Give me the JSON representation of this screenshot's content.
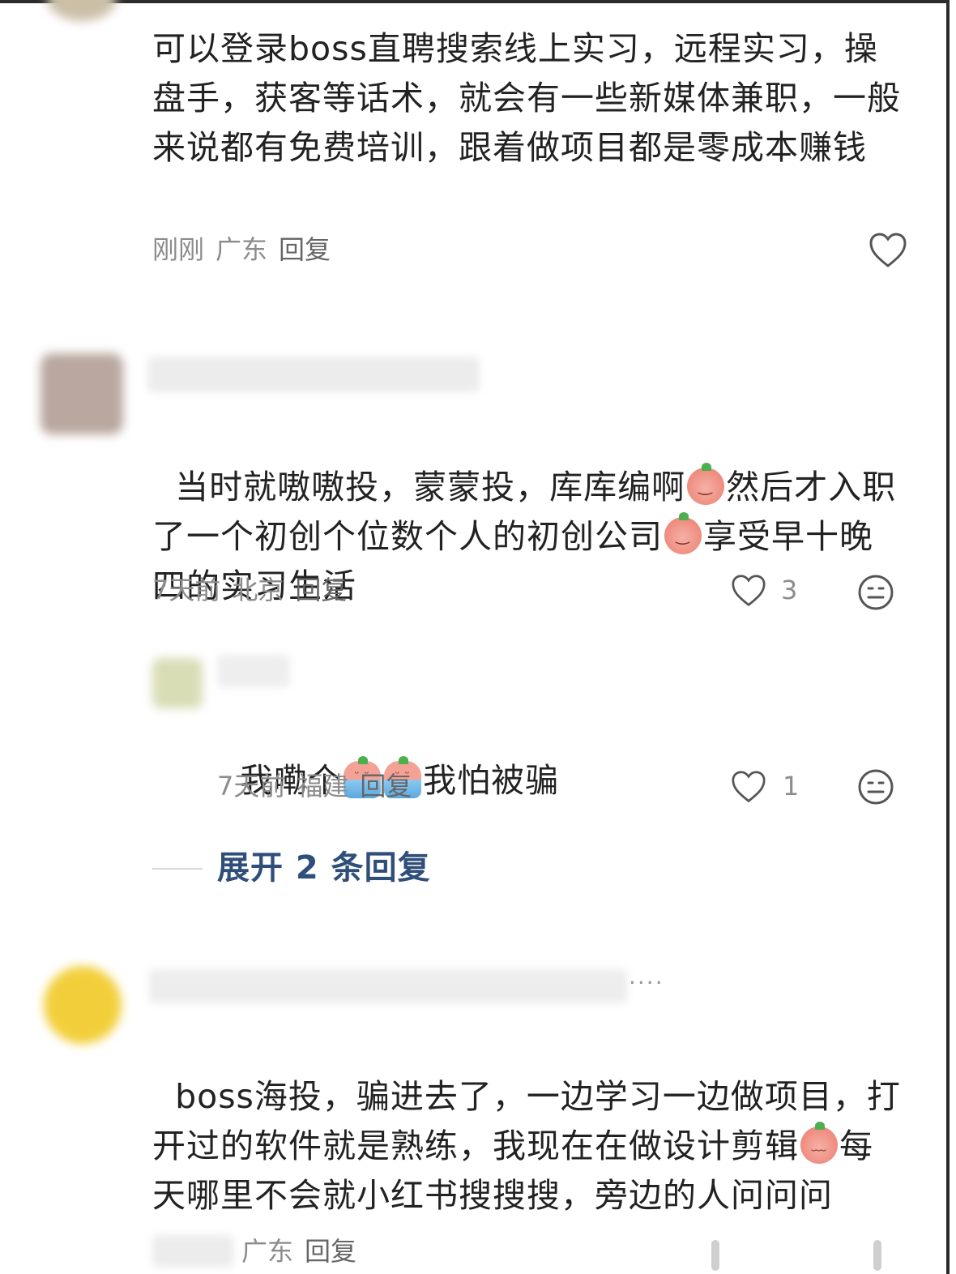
{
  "comments": [
    {
      "text": "可以登录boss直聘搜索线上实习，远程实习，操盘手，获客等话术，就会有一些新媒体兼职，一般来说都有免费培训，跟着做项目都是零成本赚钱",
      "time": "刚刚",
      "location": "广东",
      "reply_label": "回复"
    },
    {
      "text_part1": "当时就嗷嗷投，蒙蒙投，库库编啊",
      "text_part2": "然后才入职了一个初创个位数个人的初创公司",
      "text_part3": "享受早十晚四的实习生活",
      "time": "7天前",
      "location": "北京",
      "reply_label": "回复",
      "likes": "3",
      "sub_reply": {
        "text_part1": "我嘞个",
        "text_part2": "我怕被骗",
        "time": "7天前",
        "location": "福建",
        "reply_label": "回复",
        "likes": "1"
      },
      "expand_label": "展开 2 条回复"
    },
    {
      "text_part1": "boss海投，骗进去了，一边学习一边做项目，打开过的软件就是熟练，我现在在做设计剪辑",
      "text_part2": "每天哪里不会就小红书搜搜搜，旁边的人问问问",
      "location": "广东",
      "reply_label": "回复",
      "more_label": "····"
    }
  ],
  "icons": {
    "like": "heart-outline-icon",
    "dislike": "neutral-face-icon",
    "emoji_smile": "peach-smile-emoji",
    "emoji_bath": "peach-bath-emoji",
    "emoji_cry": "peach-cry-emoji"
  },
  "colors": {
    "text": "#222222",
    "meta": "#8c8c8c",
    "expand_link": "#2f4f7a",
    "background": "#ffffff"
  }
}
